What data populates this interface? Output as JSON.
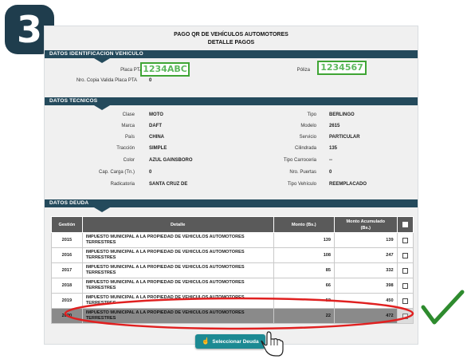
{
  "step_badge": "3",
  "header": {
    "title_line1": "PAGO QR DE VEHÍCULOS AUTOMOTORES",
    "title_line2": "DETALLE PAGOS"
  },
  "vehicle_id": {
    "section_title": "DATOS IDENTIFICACION VEHICULO",
    "placa_label": "Placa PTA",
    "placa_value": "1234ABC",
    "poliza_label": "Póliza",
    "poliza_value": "1234567",
    "copia_label": "Nro. Copia Valida Placa PTA",
    "copia_value": "0"
  },
  "tech": {
    "section_title": "DATOS TECNICOS",
    "left": [
      {
        "label": "Clase",
        "value": "MOTO"
      },
      {
        "label": "Marca",
        "value": "DAFT"
      },
      {
        "label": "País",
        "value": "CHINA"
      },
      {
        "label": "Tracción",
        "value": "SIMPLE"
      },
      {
        "label": "Color",
        "value": "AZUL GAINSBORO"
      },
      {
        "label": "Cap. Carga (Tn.)",
        "value": "0"
      },
      {
        "label": "Radicatoria",
        "value": "SANTA CRUZ DE"
      }
    ],
    "right": [
      {
        "label": "Tipo",
        "value": "BERLINGO"
      },
      {
        "label": "Modelo",
        "value": "2615"
      },
      {
        "label": "Servicio",
        "value": "PARTICULAR"
      },
      {
        "label": "Cilindrada",
        "value": "135"
      },
      {
        "label": "Tipo Carroceria",
        "value": "--"
      },
      {
        "label": "Nro. Puertas",
        "value": "0"
      },
      {
        "label": "Tipo Vehículo",
        "value": "REEMPLACADO"
      }
    ]
  },
  "debt": {
    "section_title": "DATOS DEUDA",
    "columns": {
      "gestion": "Gestión",
      "detalle": "Detalle",
      "monto": "Monto (Bs.)",
      "acumulado_line1": "Monto Acumulado",
      "acumulado_line2": "(Bs.)"
    },
    "rows": [
      {
        "gestion": "2015",
        "detalle": "IMPUESTO MUNICIPAL A LA PROPIEDAD DE VEHICULOS AUTOMOTORES TERRESTRES",
        "monto": "139",
        "acumulado": "139"
      },
      {
        "gestion": "2016",
        "detalle": "IMPUESTO MUNICIPAL A LA PROPIEDAD DE VEHICULOS AUTOMOTORES TERRESTRES",
        "monto": "108",
        "acumulado": "247"
      },
      {
        "gestion": "2017",
        "detalle": "IMPUESTO MUNICIPAL A LA PROPIEDAD DE VEHICULOS AUTOMOTORES TERRESTRES",
        "monto": "85",
        "acumulado": "332"
      },
      {
        "gestion": "2018",
        "detalle": "IMPUESTO MUNICIPAL A LA PROPIEDAD DE VEHICULOS AUTOMOTORES TERRESTRES",
        "monto": "66",
        "acumulado": "398"
      },
      {
        "gestion": "2019",
        "detalle": "IMPUESTO MUNICIPAL A LA PROPIEDAD DE VEHICULOS AUTOMOTORES TERRESTRES",
        "monto": "52",
        "acumulado": "450"
      },
      {
        "gestion": "2020",
        "detalle": "IMPUESTO MUNICIPAL A LA PROPIEDAD DE VEHICULOS AUTOMOTORES TERRESTRES",
        "monto": "22",
        "acumulado": "472"
      }
    ]
  },
  "actions": {
    "select_button": "Seleccionar Deuda"
  },
  "colors": {
    "section_bar": "#244a5c",
    "highlight_green": "#3fa535",
    "annotation_red": "#e02020",
    "button_teal": "#1c8a93"
  },
  "icons": {
    "button_icon": "pointer-hand-icon",
    "annotation_check": "checkmark-icon",
    "annotation_cursor": "hand-cursor-icon"
  }
}
